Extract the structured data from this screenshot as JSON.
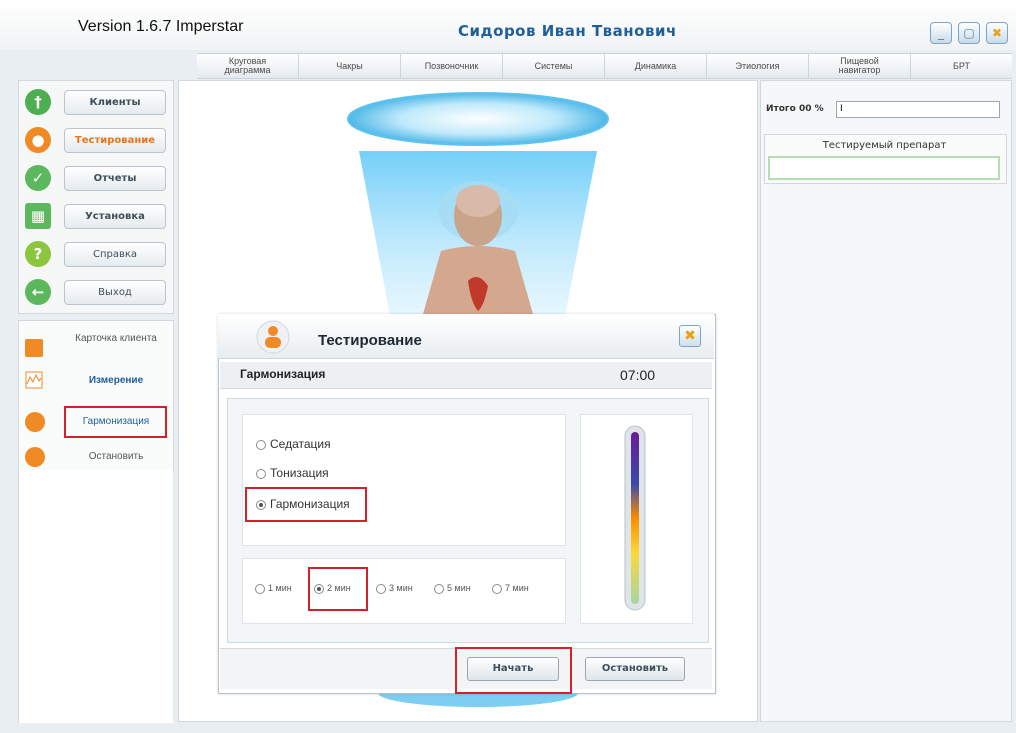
{
  "window": {
    "version": "Version 1.6.7 Imperstar",
    "user_name": "Сидоров  Иван  Тванович",
    "minimize": "_",
    "maximize": "▢",
    "close": "✖"
  },
  "tabs": [
    {
      "line1": "Круговая",
      "line2": "диаграмма"
    },
    {
      "line1": "Чакры",
      "line2": ""
    },
    {
      "line1": "Позвоночник",
      "line2": ""
    },
    {
      "line1": "Системы",
      "line2": ""
    },
    {
      "line1": "Динамика",
      "line2": ""
    },
    {
      "line1": "Этиология",
      "line2": ""
    },
    {
      "line1": "Пищевой",
      "line2": "навигатор"
    },
    {
      "line1": "БРТ",
      "line2": ""
    }
  ],
  "sidebar": {
    "items": [
      {
        "label": "Клиенты",
        "icon": "person-icon",
        "color": "#4caf50"
      },
      {
        "label": "Тестирование",
        "icon": "user-test-icon",
        "color": "#f08a24",
        "active": true
      },
      {
        "label": "Отчеты",
        "icon": "checkmark-icon",
        "color": "#5cb85c"
      },
      {
        "label": "Установка",
        "icon": "settings-grid-icon",
        "color": "#5cb85c"
      },
      {
        "label": "Справка",
        "icon": "help-icon",
        "color": "#8cc63f"
      },
      {
        "label": "Выход",
        "icon": "exit-arrow-icon",
        "color": "#5cb85c"
      }
    ],
    "sub_items": [
      {
        "label": "Карточка клиента",
        "icon": "client-card-icon"
      },
      {
        "label": "Измерение",
        "icon": "measurement-icon"
      },
      {
        "label": "Гармонизация",
        "icon": "harmonization-icon"
      },
      {
        "label": "Остановить",
        "icon": "stop-icon"
      }
    ]
  },
  "right_panel": {
    "total_label": "Итого",
    "total_value": "00 %",
    "total_input": "I",
    "preparation_label": "Тестируемый препарат",
    "preparation_value": ""
  },
  "dialog": {
    "title": "Тестирование",
    "close": "✖",
    "section": "Гармонизация",
    "timer": "07:00",
    "modes": [
      {
        "label": "Седатация",
        "selected": false
      },
      {
        "label": "Тонизация",
        "selected": false
      },
      {
        "label": "Гармонизация",
        "selected": true
      }
    ],
    "durations": [
      {
        "label": "1 мин",
        "selected": false
      },
      {
        "label": "2 мин",
        "selected": true
      },
      {
        "label": "3 мин",
        "selected": false
      },
      {
        "label": "5 мин",
        "selected": false
      },
      {
        "label": "7 мин",
        "selected": false
      }
    ],
    "start_button": "Начать",
    "stop_button": "Остановить"
  },
  "colors": {
    "accent": "#1f5f9a",
    "highlight": "#d3202b",
    "active_text": "#e8751a"
  }
}
